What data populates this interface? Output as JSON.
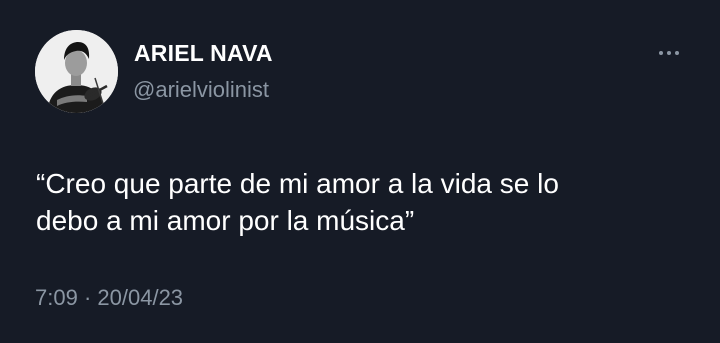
{
  "tweet": {
    "author": {
      "display_name": "ARIEL NAVA",
      "handle": "@arielviolinist",
      "avatar_icon": "profile-photo-violinist"
    },
    "more_icon": "more-horizontal-icon",
    "text_lines": [
      "“Creo que parte de mi amor a la vida se lo",
      "debo a mi amor por la música”"
    ],
    "time": "7:09",
    "separator": "·",
    "date": "20/04/23"
  },
  "colors": {
    "background": "#161b26",
    "primary_text": "#ffffff",
    "secondary_text": "#8b96a3"
  }
}
